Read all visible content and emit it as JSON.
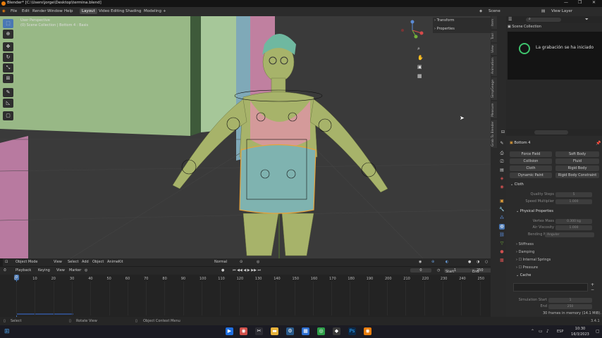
{
  "titlebar": {
    "title": "Blender* [C:\\Users\\jorge\\Desktop\\termina.blend]",
    "minimize": "—",
    "maximize": "❐",
    "close": "✕"
  },
  "menu": {
    "items": [
      "File",
      "Edit",
      "Render",
      "Window",
      "Help"
    ],
    "workspaces": [
      "Layout",
      "Video Editing",
      "Shading",
      "Modeling"
    ],
    "add": "+",
    "scene": "Scene",
    "view_layer": "View Layer"
  },
  "viewport": {
    "line1": "User Perspective",
    "line2": "(0) Scene Collection | Bottom 4 : Basis",
    "npanel_transform": "Transform",
    "npanel_properties": "Properties"
  },
  "vp_header": {
    "mode": "Object Mode",
    "view": "View",
    "select": "Select",
    "add": "Add",
    "object": "Object",
    "animkit": "AnimeKit",
    "shading": "Normal"
  },
  "timeline_header": {
    "playback": "Playback",
    "keying": "Keying",
    "view": "View",
    "marker": "Marker",
    "frame": "0",
    "start_label": "Start",
    "start": "1",
    "end_label": "End",
    "end": "250"
  },
  "timeline": {
    "ticks": [
      "0",
      "10",
      "20",
      "30",
      "40",
      "50",
      "60",
      "70",
      "80",
      "90",
      "100",
      "110",
      "120",
      "130",
      "140",
      "150",
      "160",
      "170",
      "180",
      "190",
      "200",
      "210",
      "220",
      "230",
      "240",
      "250"
    ],
    "current": "0"
  },
  "sidetabs": [
    "Item",
    "Tool",
    "View",
    "Animation",
    "SimpGeage",
    "Measure",
    "Grab To Blender"
  ],
  "outliner": {
    "root": "Scene Collection",
    "notification": "La grabación se ha iniciado"
  },
  "props": {
    "object_name": "Bottom 4",
    "buttons": [
      {
        "left": "Force Field",
        "right": "Soft Body"
      },
      {
        "left": "Collision",
        "right": "Fluid"
      },
      {
        "left": "Cloth",
        "right": "Rigid Body"
      },
      {
        "left": "Dynamic Paint",
        "right": "Rigid Body Constraint"
      }
    ],
    "cloth_label": "Cloth",
    "quality_label": "Quality Steps",
    "quality_value": "5",
    "speed_label": "Speed Multiplier",
    "speed_value": "1.000",
    "physical_label": "Physical Properties",
    "vertex_mass_label": "Vertex Mass",
    "vertex_mass_value": "0.300 kg",
    "air_label": "Air Viscosity",
    "air_value": "1.000",
    "bending_label": "Bending Model",
    "bending_value": "Angular",
    "stiffness": "Stiffness",
    "damping": "Damping",
    "internal": "Internal Springs",
    "pressure": "Pressure",
    "cache": "Cache",
    "sim_start_label": "Simulation Start",
    "sim_start_value": "1",
    "end_label": "End",
    "end_value": "250",
    "cache_info": "30 frames in memory (14.1 MiB)."
  },
  "status": {
    "select": "Select",
    "rotate": "Rotate View",
    "context": "Object Context Menu",
    "version": "3.4.1"
  },
  "taskbar": {
    "lang": "ESP",
    "time": "10:30",
    "date": "16/3/2023"
  },
  "colors": {
    "accent": "#4a78b4",
    "active_orange": "#e8a33a",
    "bg": "#393939"
  }
}
